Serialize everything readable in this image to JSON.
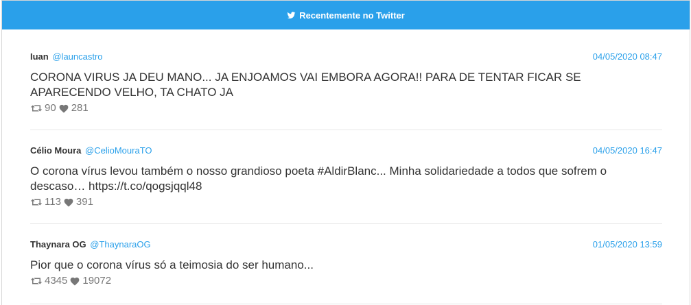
{
  "header": {
    "title": "Recentemente no Twitter",
    "icon": "twitter-bird-icon"
  },
  "tweets": [
    {
      "name": "Iuan",
      "handle": "@launcastro",
      "date": "04/05/2020 08:47",
      "text": "CORONA VIRUS JA DEU MANO... JA ENJOAMOS VAI EMBORA AGORA!! PARA DE TENTAR FICAR SE APARECENDO VELHO, TA CHATO JA",
      "retweets": "90",
      "likes": "281"
    },
    {
      "name": "Célio Moura",
      "handle": "@CelioMouraTO",
      "date": "04/05/2020 16:47",
      "text": "O corona vírus levou também o nosso grandioso poeta #AldirBlanc... Minha solidariedade a todos que sofrem o descaso… https://t.co/qogsjqql48",
      "retweets": "113",
      "likes": "391"
    },
    {
      "name": "Thaynara OG",
      "handle": "@ThaynaraOG",
      "date": "01/05/2020 13:59",
      "text": "Pior que o corona vírus só a teimosia do ser humano...",
      "retweets": "4345",
      "likes": "19072"
    }
  ],
  "colors": {
    "accent": "#2aa0ea",
    "text": "#333333",
    "muted": "#777777"
  }
}
